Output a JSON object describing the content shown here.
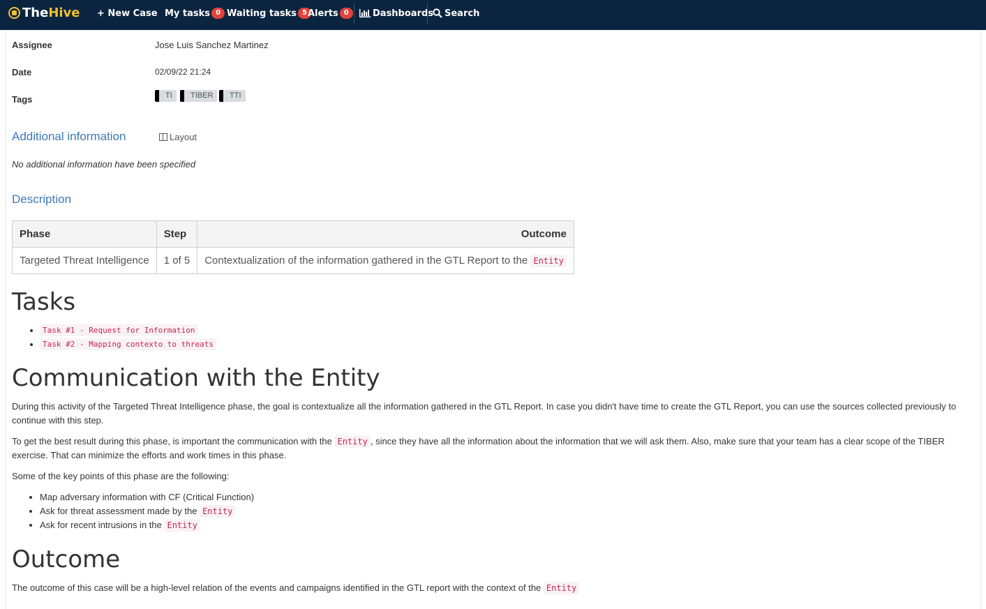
{
  "navbar": {
    "brand_the": "The",
    "brand_hive": "Hive",
    "new_case": "+ New Case",
    "my_tasks": "My tasks",
    "my_tasks_count": "0",
    "waiting_tasks": "Waiting tasks",
    "waiting_tasks_count": "5",
    "alerts": "Alerts",
    "alerts_count": "0",
    "dashboards": "Dashboards",
    "search": "Search"
  },
  "details": {
    "assignee_label": "Assignee",
    "assignee_value": "Jose Luis Sanchez Martinez",
    "date_label": "Date",
    "date_value": "02/09/22 21:24",
    "tags_label": "Tags",
    "tags": [
      "TI",
      "TIBER",
      "TTI"
    ]
  },
  "additional": {
    "title": "Additional information",
    "layout_label": "Layout",
    "empty_text": "No additional information have been specified"
  },
  "description": {
    "title": "Description",
    "table": {
      "headers": [
        "Phase",
        "Step",
        "Outcome"
      ],
      "row": {
        "phase": "Targeted Threat Intelligence",
        "step": "1 of 5",
        "outcome": "Contextualization of the information gathered in the GTL Report to the",
        "outcome_code": "Entity"
      }
    },
    "tasks_heading": "Tasks",
    "tasks": [
      "Task #1 - Request for Information",
      "Task #2 - Mapping contexto to threats"
    ],
    "comm_heading": "Communication with the Entity",
    "para1": "During this activity of the Targeted Threat Intelligence phase, the goal is contextualize all the information gathered in the GTL Report. In case you didn't have time to create the GTL Report, you can use the sources collected previously to continue with this step.",
    "para2_before": "To get the best result during this phase, is important the communication with the",
    "para2_code": "Entity",
    "para2_after": ", since they have all the information about the information that we will ask them. Also, make sure that your team has a clear scope of the TIBER exercise. That can minimize the efforts and work times in this phase.",
    "para3": "Some of the key points of this phase are the following:",
    "key_points": [
      {
        "text": "Map adversary information with CF (Critical Function)",
        "code": ""
      },
      {
        "text": "Ask for threat assessment made by the",
        "code": "Entity"
      },
      {
        "text": "Ask for recent intrusions in the",
        "code": "Entity"
      }
    ],
    "outcome_heading": "Outcome",
    "outcome_text": "The outcome of this case will be a high-level relation of the events and campaigns identified in the GTL report with the context of the",
    "outcome_code": "Entity"
  }
}
